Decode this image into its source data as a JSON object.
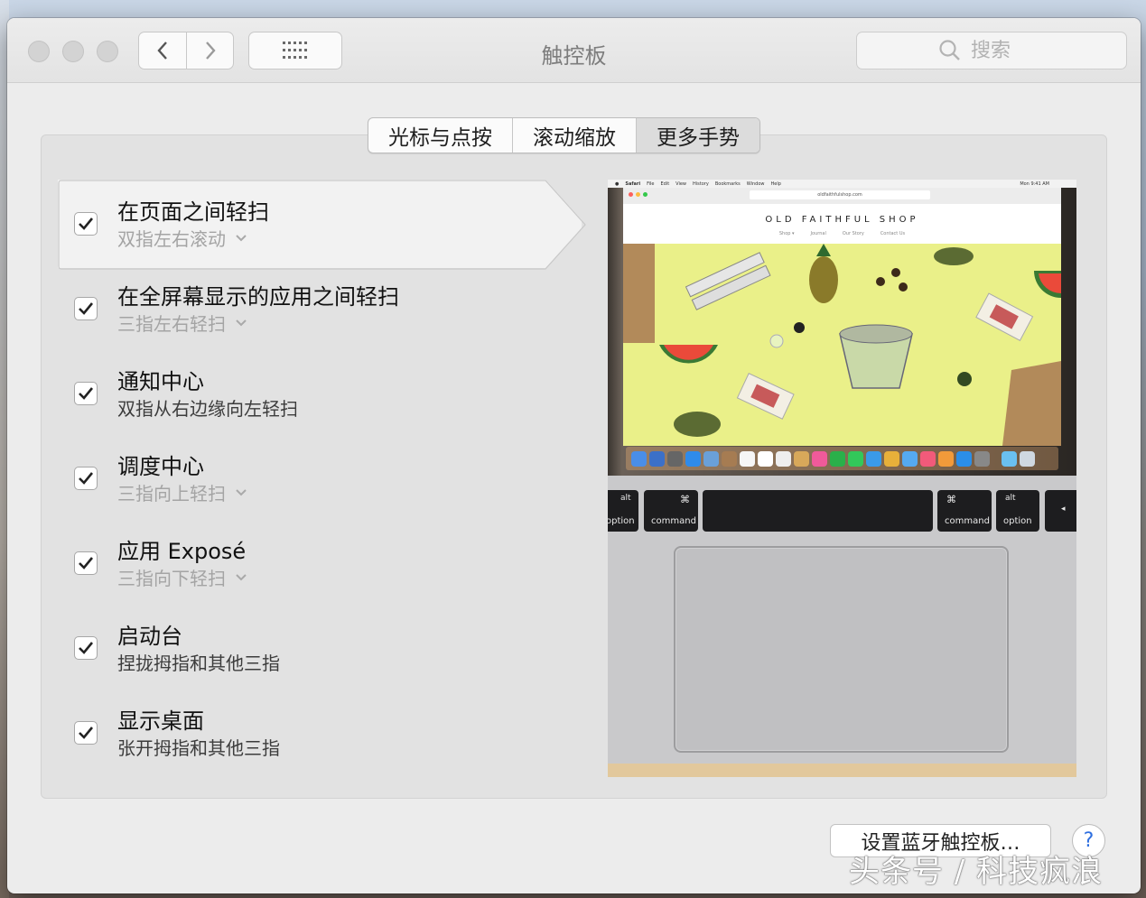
{
  "window": {
    "title": "触控板"
  },
  "search": {
    "placeholder": "搜索"
  },
  "tabs": [
    {
      "label": "光标与点按"
    },
    {
      "label": "滚动缩放"
    },
    {
      "label": "更多手势"
    }
  ],
  "selected_tab": "更多手势",
  "gestures": [
    {
      "title": "在页面之间轻扫",
      "subtitle": "双指左右滚动",
      "has_menu": true,
      "checked": true,
      "selected": true
    },
    {
      "title": "在全屏幕显示的应用之间轻扫",
      "subtitle": "三指左右轻扫",
      "has_menu": true,
      "checked": true
    },
    {
      "title": "通知中心",
      "subtitle": "双指从右边缘向左轻扫",
      "has_menu": false,
      "checked": true
    },
    {
      "title": "调度中心",
      "subtitle": "三指向上轻扫",
      "has_menu": true,
      "checked": true
    },
    {
      "title": "应用 Exposé",
      "subtitle": "三指向下轻扫",
      "has_menu": true,
      "checked": true
    },
    {
      "title": "启动台",
      "subtitle": "捏拢拇指和其他三指",
      "has_menu": false,
      "checked": true
    },
    {
      "title": "显示桌面",
      "subtitle": "张开拇指和其他三指",
      "has_menu": false,
      "checked": true
    }
  ],
  "preview": {
    "menubar": [
      "Safari",
      "File",
      "Edit",
      "View",
      "History",
      "Bookmarks",
      "Window",
      "Help"
    ],
    "clock": "Mon 9:41 AM",
    "url": "oldfaithfulshop.com",
    "shop_title": "OLD FAITHFUL SHOP",
    "shop_nav": [
      "Shop ▾",
      "Journal",
      "Our Story",
      "Contact Us"
    ],
    "keys": {
      "alt": "alt",
      "option": "option",
      "command": "command",
      "cmd_symbol": "⌘",
      "arrow": "◂"
    }
  },
  "buttons": {
    "setup": "设置蓝牙触控板…",
    "help": "?"
  },
  "watermark": "头条号 / 科技疯浪",
  "colors": {
    "panel": "#e2e2e2",
    "window": "#ececec",
    "help_accent": "#2e6fe0"
  }
}
